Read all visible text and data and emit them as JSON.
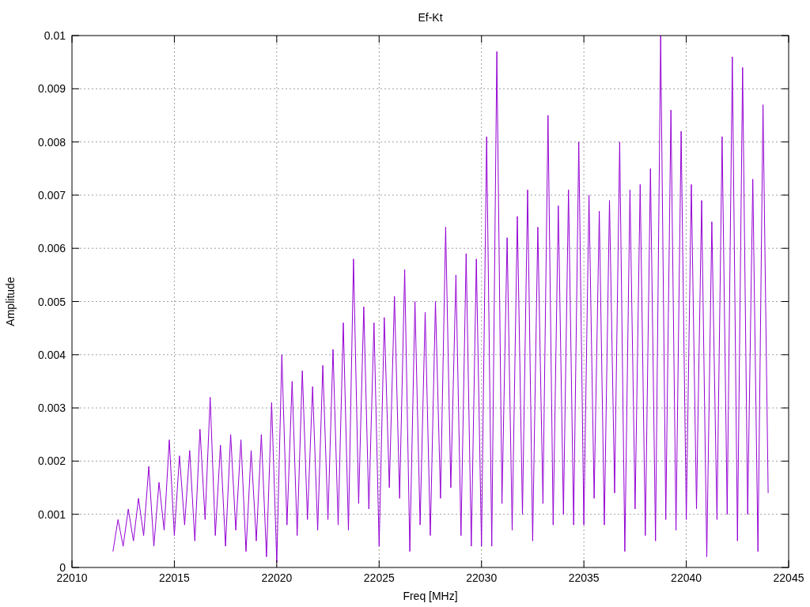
{
  "chart": {
    "chart_data": {
      "type": "line",
      "title": "Ef-Kt",
      "xlabel": "Freq [MHz]",
      "ylabel": "Amplitude",
      "xlim": [
        22010,
        22045
      ],
      "ylim": [
        0,
        0.01
      ],
      "xticks": [
        22010,
        22015,
        22020,
        22025,
        22030,
        22035,
        22040,
        22045
      ],
      "yticks": [
        0,
        0.001,
        0.002,
        0.003,
        0.004,
        0.005,
        0.006,
        0.007,
        0.008,
        0.009,
        0.01
      ],
      "x": [
        22012,
        22012.25,
        22012.5,
        22012.75,
        22013,
        22013.25,
        22013.5,
        22013.75,
        22014,
        22014.25,
        22014.5,
        22014.75,
        22015,
        22015.25,
        22015.5,
        22015.75,
        22016,
        22016.25,
        22016.5,
        22016.75,
        22017,
        22017.25,
        22017.5,
        22017.75,
        22018,
        22018.25,
        22018.5,
        22018.75,
        22019,
        22019.25,
        22019.5,
        22019.75,
        22020,
        22020.25,
        22020.5,
        22020.75,
        22021,
        22021.25,
        22021.5,
        22021.75,
        22022,
        22022.25,
        22022.5,
        22022.75,
        22023,
        22023.25,
        22023.5,
        22023.75,
        22024,
        22024.25,
        22024.5,
        22024.75,
        22025,
        22025.25,
        22025.5,
        22025.75,
        22026,
        22026.25,
        22026.5,
        22026.75,
        22027,
        22027.25,
        22027.5,
        22027.75,
        22028,
        22028.25,
        22028.5,
        22028.75,
        22029,
        22029.25,
        22029.5,
        22029.75,
        22030,
        22030.25,
        22030.5,
        22030.75,
        22031,
        22031.25,
        22031.5,
        22031.75,
        22032,
        22032.25,
        22032.5,
        22032.75,
        22033,
        22033.25,
        22033.5,
        22033.75,
        22034,
        22034.25,
        22034.5,
        22034.75,
        22035,
        22035.25,
        22035.5,
        22035.75,
        22036,
        22036.25,
        22036.5,
        22036.75,
        22037,
        22037.25,
        22037.5,
        22037.75,
        22038,
        22038.25,
        22038.5,
        22038.75,
        22039,
        22039.25,
        22039.5,
        22039.75,
        22040,
        22040.25,
        22040.5,
        22040.75,
        22041,
        22041.25,
        22041.5,
        22041.75,
        22042,
        22042.25,
        22042.5,
        22042.75,
        22043,
        22043.25,
        22043.5,
        22043.75,
        22044
      ],
      "grid": true,
      "series": [
        {
          "color": "#9400d3",
          "values": [
            0.0003,
            0.0009,
            0.0004,
            0.0011,
            0.0005,
            0.0013,
            0.0006,
            0.0019,
            0.0004,
            0.0016,
            0.0007,
            0.0024,
            0.0006,
            0.0021,
            0.0008,
            0.0022,
            0.0005,
            0.0026,
            0.0009,
            0.0032,
            0.0006,
            0.0023,
            0.0004,
            0.0025,
            0.0007,
            0.0024,
            0.0003,
            0.0022,
            0.0005,
            0.0025,
            0.0002,
            0.0031,
            0.0001,
            0.004,
            0.0008,
            0.0035,
            0.0006,
            0.0037,
            0.0009,
            0.0034,
            0.0007,
            0.0038,
            0.0009,
            0.0041,
            0.0008,
            0.0046,
            0.0007,
            0.0058,
            0.0012,
            0.0049,
            0.0011,
            0.0046,
            0.0004,
            0.0047,
            0.0015,
            0.0051,
            0.0013,
            0.0056,
            0.0003,
            0.005,
            0.0008,
            0.0048,
            0.0006,
            0.005,
            0.0013,
            0.0064,
            0.0015,
            0.0055,
            0.0006,
            0.0059,
            0.0004,
            0.0058,
            0.0004,
            0.0081,
            0.0004,
            0.0097,
            0.0012,
            0.0062,
            0.0007,
            0.0066,
            0.001,
            0.0071,
            0.0005,
            0.0064,
            0.0012,
            0.0085,
            0.0008,
            0.0068,
            0.001,
            0.0071,
            0.0008,
            0.008,
            0.0008,
            0.007,
            0.0013,
            0.0067,
            0.0008,
            0.0069,
            0.0014,
            0.008,
            0.0003,
            0.0071,
            0.0011,
            0.0072,
            0.0006,
            0.0075,
            0.0005,
            0.01,
            0.0009,
            0.0086,
            0.0007,
            0.0082,
            0.0009,
            0.0072,
            0.0011,
            0.0069,
            0.0002,
            0.0065,
            0.0009,
            0.0081,
            0.001,
            0.0096,
            0.0005,
            0.0094,
            0.001,
            0.0073,
            0.0003,
            0.0087,
            0.0014
          ]
        }
      ]
    }
  }
}
